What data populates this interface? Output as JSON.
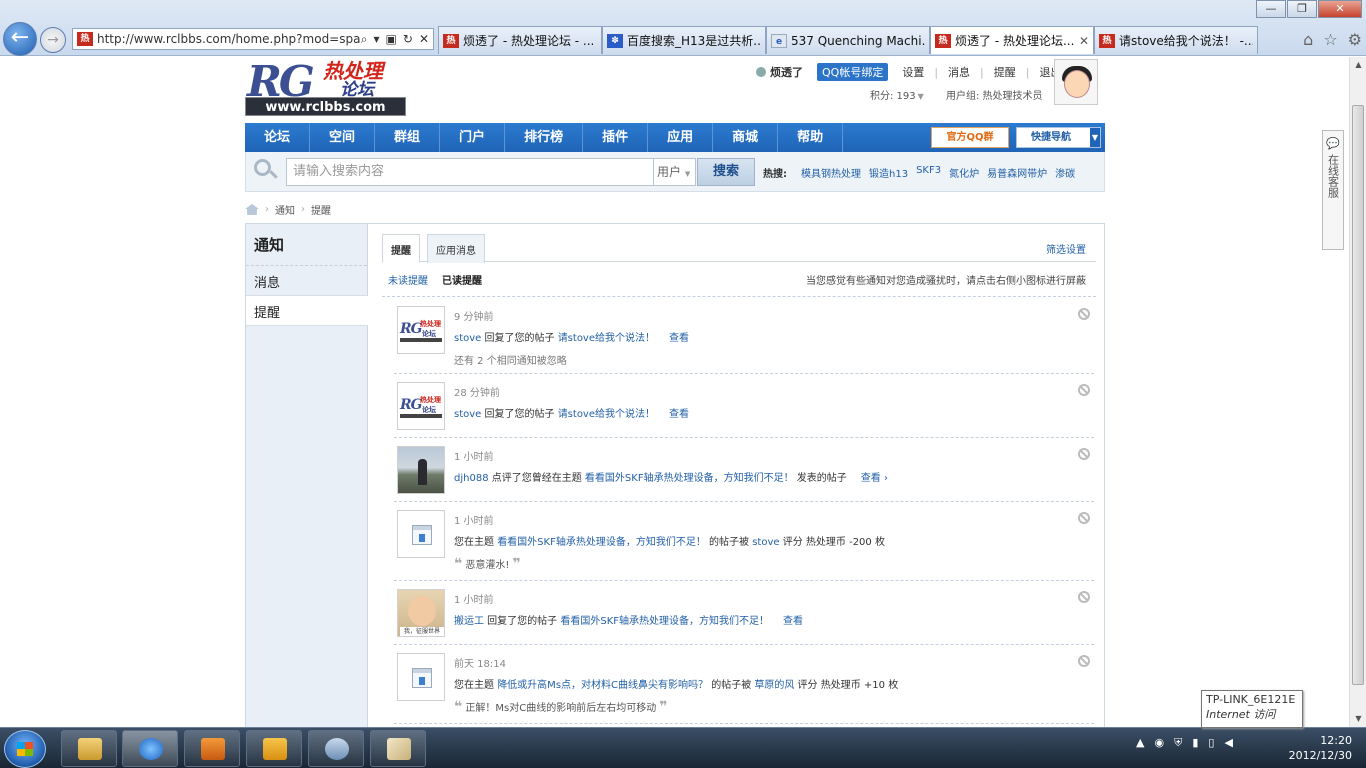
{
  "browser": {
    "address": "http://www.rclbbs.com/home.php?mod=spa",
    "favicon": "热",
    "tabs": [
      {
        "title": "烦透了 - 热处理论坛 - ...",
        "icon": "rcl",
        "active": false
      },
      {
        "title": "百度搜索_H13是过共析...",
        "icon": "baidu",
        "active": false
      },
      {
        "title": "537 Quenching Machi...",
        "icon": "generic",
        "active": false
      },
      {
        "title": "烦透了 - 热处理论坛...",
        "icon": "rcl",
        "active": true
      },
      {
        "title": "请stove给我个说法！ -...",
        "icon": "rcl",
        "active": false
      }
    ]
  },
  "logo": {
    "rg": "RG",
    "cn1": "热处理",
    "cn2": "论坛",
    "www": "www.rclbbs.com"
  },
  "user": {
    "name": "烦透了",
    "qq_bind": "QQ帐号绑定",
    "links": [
      "设置",
      "消息",
      "提醒",
      "退出"
    ],
    "points": "积分: 193",
    "group": "用户组: 热处理技术员"
  },
  "nav": {
    "items": [
      "论坛",
      "空间",
      "群组",
      "门户",
      "排行榜",
      "插件",
      "应用",
      "商城",
      "帮助"
    ],
    "qq_group": "官方QQ群",
    "quick_nav": "快捷导航"
  },
  "search": {
    "placeholder": "请输入搜索内容",
    "scope": "用户",
    "button": "搜索",
    "hot_label": "热搜:",
    "hot": [
      "模具钢热处理",
      "锻造h13",
      "SKF3",
      "氮化炉",
      "易普森网带炉",
      "渗碳"
    ]
  },
  "breadcrumb": [
    "通知",
    "提醒"
  ],
  "sidebar": {
    "title": "通知",
    "items": [
      "消息",
      "提醒"
    ]
  },
  "tabs": {
    "remind": "提醒",
    "app_msg": "应用消息",
    "filter_settings": "筛选设置",
    "unread": "未读提醒",
    "read": "已读提醒",
    "hint": "当您感觉有些通知对您造成骚扰时，请点击右侧小图标进行屏蔽"
  },
  "notifications": [
    {
      "time": "9 分钟前",
      "user": "stove",
      "action": " 回复了您的帖子 ",
      "topic": "请stove给我个说法！",
      "view": "查看",
      "extra": "还有 2 个相同通知被忽略",
      "quote": ""
    },
    {
      "time": "28 分钟前",
      "user": "stove",
      "action": " 回复了您的帖子 ",
      "topic": "请stove给我个说法！",
      "view": "查看",
      "extra": "",
      "quote": ""
    },
    {
      "time": "1 小时前",
      "user": "djh088",
      "action": " 点评了您曾经在主题 ",
      "topic": "看看国外SKF轴承热处理设备，方知我们不足！",
      "suffix": " 发表的帖子",
      "view": "查看 ›",
      "extra": "",
      "quote": ""
    },
    {
      "time": "1 小时前",
      "prefix": "您在主题 ",
      "topic": "看看国外SKF轴承热处理设备，方知我们不足！",
      "mid": " 的帖子被 ",
      "user": "stove",
      "tail": " 评分 热处理币 -200 枚",
      "quote": "恶意灌水!"
    },
    {
      "time": "1 小时前",
      "user": "搬运工",
      "action": " 回复了您的帖子 ",
      "topic": "看看国外SKF轴承热处理设备，方知我们不足！",
      "view": "查看",
      "extra": "",
      "quote": ""
    },
    {
      "time": "前天 18:14",
      "prefix": "您在主题 ",
      "topic": "降低或升高Ms点，对材料C曲线鼻尖有影响吗？",
      "mid": " 的帖子被 ",
      "user": "草原的风",
      "tail": " 评分 热处理币 +10 枚",
      "quote": "正解！Ms对C曲线的影响前后左右均可移动"
    }
  ],
  "service": "在线客服",
  "photo_caption": "我，征服世界",
  "tray": {
    "tooltip_title": "TP-LINK_6E121E",
    "tooltip_sub": "Internet 访问",
    "time": "12:20",
    "date": "2012/12/30"
  }
}
